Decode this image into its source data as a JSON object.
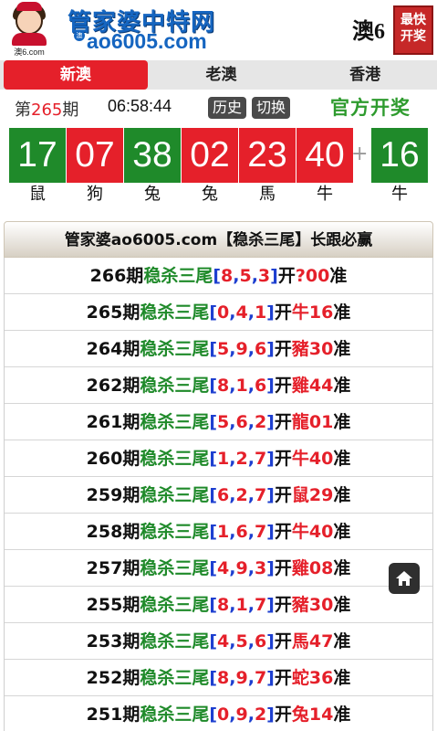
{
  "header": {
    "avatar_tag": "澳6.com",
    "site_name": "管家婆中特网",
    "badge": "澳",
    "domain": "ao6005.com",
    "brand_right": "澳6",
    "seal": [
      "最快",
      "开奖"
    ]
  },
  "tabs": [
    {
      "label": "新澳",
      "active": true
    },
    {
      "label": "老澳",
      "active": false
    },
    {
      "label": "香港",
      "active": false
    }
  ],
  "draw": {
    "issue_prefix": "第",
    "issue_number": "265",
    "issue_suffix": "期",
    "time": "06:58:44",
    "history_label": "历史",
    "switch_label": "切换",
    "official_label": "官方开奖"
  },
  "balls": [
    {
      "number": "17",
      "zodiac": "鼠",
      "color": "green"
    },
    {
      "number": "07",
      "zodiac": "狗",
      "color": "red"
    },
    {
      "number": "38",
      "zodiac": "兔",
      "color": "green"
    },
    {
      "number": "02",
      "zodiac": "兔",
      "color": "red"
    },
    {
      "number": "23",
      "zodiac": "馬",
      "color": "red"
    },
    {
      "number": "40",
      "zodiac": "牛",
      "color": "red"
    }
  ],
  "plus": "+",
  "special_ball": {
    "number": "16",
    "zodiac": "牛",
    "color": "green"
  },
  "banner": "管家婆ao6005.com【稳杀三尾】长跟必赢",
  "records": [
    {
      "period": "266期",
      "label": "稳杀三尾",
      "digits": [
        "8",
        "5",
        "3"
      ],
      "open": "开",
      "result": "?00",
      "suffix": "准"
    },
    {
      "period": "265期",
      "label": "稳杀三尾",
      "digits": [
        "0",
        "4",
        "1"
      ],
      "open": "开",
      "result": "牛16",
      "suffix": "准"
    },
    {
      "period": "264期",
      "label": "稳杀三尾",
      "digits": [
        "5",
        "9",
        "6"
      ],
      "open": "开",
      "result": "豬30",
      "suffix": "准"
    },
    {
      "period": "262期",
      "label": "稳杀三尾",
      "digits": [
        "8",
        "1",
        "6"
      ],
      "open": "开",
      "result": "雞44",
      "suffix": "准"
    },
    {
      "period": "261期",
      "label": "稳杀三尾",
      "digits": [
        "5",
        "6",
        "2"
      ],
      "open": "开",
      "result": "龍01",
      "suffix": "准"
    },
    {
      "period": "260期",
      "label": "稳杀三尾",
      "digits": [
        "1",
        "2",
        "7"
      ],
      "open": "开",
      "result": "牛40",
      "suffix": "准"
    },
    {
      "period": "259期",
      "label": "稳杀三尾",
      "digits": [
        "6",
        "2",
        "7"
      ],
      "open": "开",
      "result": "鼠29",
      "suffix": "准"
    },
    {
      "period": "258期",
      "label": "稳杀三尾",
      "digits": [
        "1",
        "6",
        "7"
      ],
      "open": "开",
      "result": "牛40",
      "suffix": "准"
    },
    {
      "period": "257期",
      "label": "稳杀三尾",
      "digits": [
        "4",
        "9",
        "3"
      ],
      "open": "开",
      "result": "雞08",
      "suffix": "准"
    },
    {
      "period": "255期",
      "label": "稳杀三尾",
      "digits": [
        "8",
        "1",
        "7"
      ],
      "open": "开",
      "result": "豬30",
      "suffix": "准"
    },
    {
      "period": "253期",
      "label": "稳杀三尾",
      "digits": [
        "4",
        "5",
        "6"
      ],
      "open": "开",
      "result": "馬47",
      "suffix": "准"
    },
    {
      "period": "252期",
      "label": "稳杀三尾",
      "digits": [
        "8",
        "9",
        "7"
      ],
      "open": "开",
      "result": "蛇36",
      "suffix": "准"
    },
    {
      "period": "251期",
      "label": "稳杀三尾",
      "digits": [
        "0",
        "9",
        "2"
      ],
      "open": "开",
      "result": "兔14",
      "suffix": "准"
    }
  ],
  "icons": {
    "home": "home-icon"
  }
}
